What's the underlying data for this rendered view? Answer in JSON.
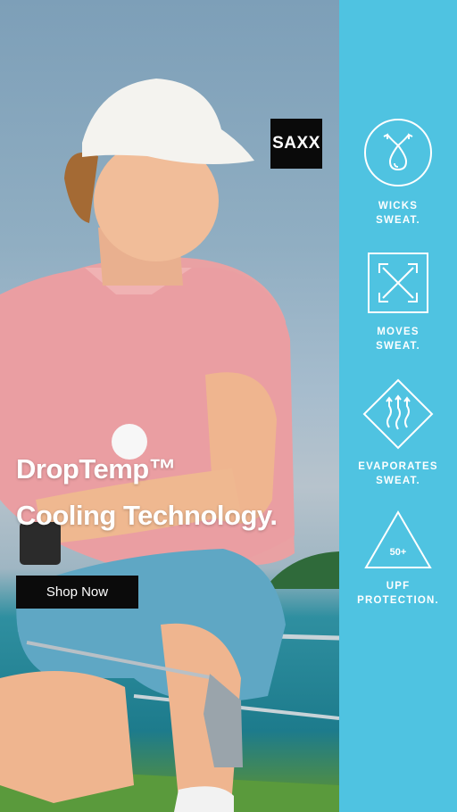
{
  "brand": {
    "logo_text": "SAXX"
  },
  "hero": {
    "headline_line1": "DropTemp™",
    "headline_line2": "Cooling Technology.",
    "cta_label": "Shop Now"
  },
  "features": [
    {
      "icon": "sweat-drop-icon",
      "line1": "WICKS",
      "line2": "SWEAT."
    },
    {
      "icon": "expand-arrows-icon",
      "line1": "MOVES",
      "line2": "SWEAT."
    },
    {
      "icon": "heat-waves-icon",
      "line1": "EVAPORATES",
      "line2": "SWEAT."
    },
    {
      "icon": "upf-triangle-icon",
      "badge": "50+",
      "line1": "UPF",
      "line2": "PROTECTION."
    }
  ],
  "colors": {
    "panel": "#4fc3e1",
    "button": "#0b0b0b",
    "logo_bg": "#0a0a0a",
    "shirt": "#e9a1a3",
    "shorts": "#5fa7c4"
  }
}
